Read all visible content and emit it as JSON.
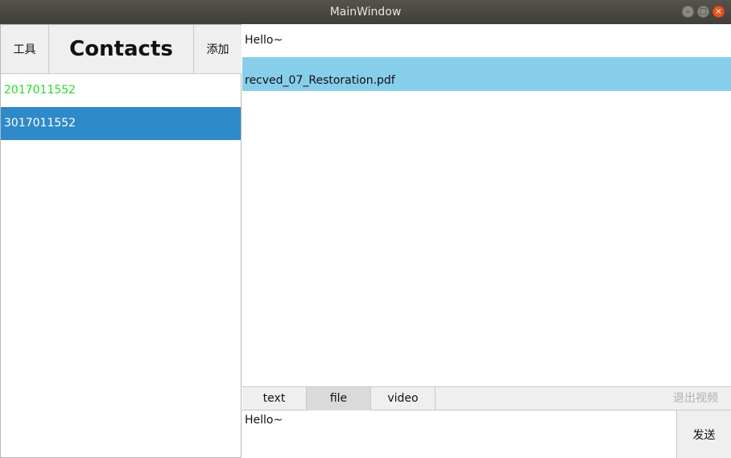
{
  "window": {
    "title": "MainWindow"
  },
  "sidebar": {
    "tools_label": "工具",
    "heading": "Contacts",
    "add_label": "添加",
    "contacts": [
      {
        "name": "2017011552",
        "status": "online"
      },
      {
        "name": "3017011552",
        "status": "selected"
      }
    ]
  },
  "chat": {
    "messages": [
      {
        "text": "Hello~"
      },
      {
        "text": "recved_07_Restoration.pdf"
      }
    ]
  },
  "tabs": {
    "items": [
      {
        "label": "text"
      },
      {
        "label": "file"
      },
      {
        "label": "video"
      }
    ],
    "selected": "file",
    "exit_video_label": "退出视频"
  },
  "composer": {
    "value": "Hello~",
    "send_label": "发送"
  },
  "colors": {
    "accent": "#2f8ac9",
    "file_highlight": "#87ceeb",
    "online": "#2ad92a"
  }
}
